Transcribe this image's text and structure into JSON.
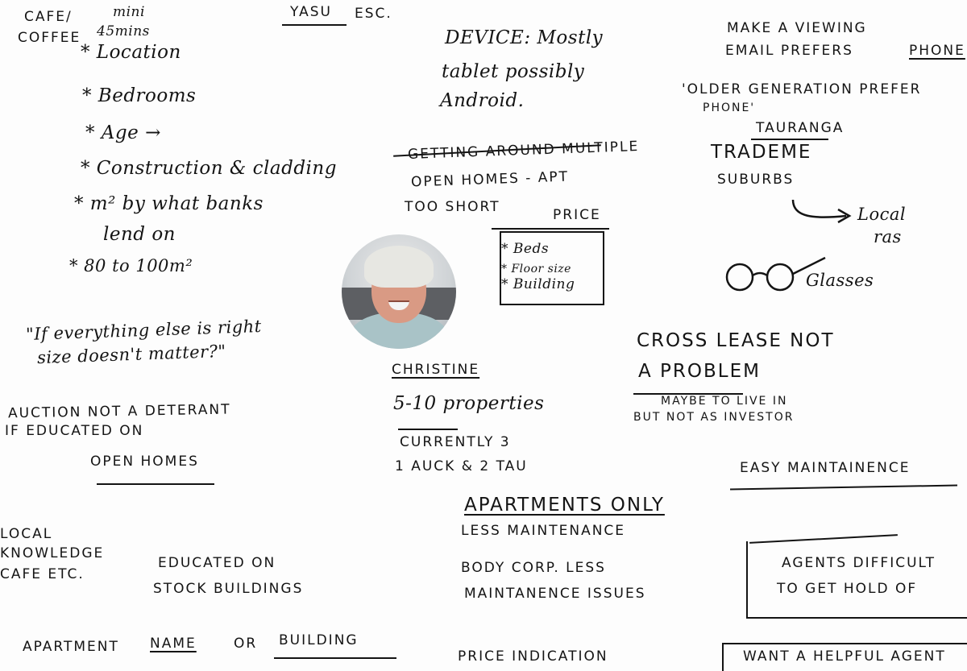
{
  "colors": {
    "ink": "#141414",
    "paper": "#fdfdfd"
  },
  "persona": {
    "name": "Christine",
    "photo_icon": "person-photo"
  },
  "notes": {
    "cafe": "CAFE/",
    "coffee": "COFFEE",
    "mini": "mini",
    "mins": "45mins",
    "yasu": "YASU",
    "esc": "esc.",
    "priorities": [
      "* Location",
      "* Bedrooms",
      "* Age →",
      "* Construction & cladding",
      "* m² by what banks",
      "lend on",
      "* 80 to 100m²"
    ],
    "quote_line1": "\"If everything else is right",
    "quote_line2": "size doesn't matter?\"",
    "auction_line1": "AUCTION NOT A DETERANT",
    "auction_line2": "IF EDUCATED ON",
    "open_homes": "OPEN HOMES",
    "local_line1": "LOCAL",
    "local_line2": "KNOWLEDGE",
    "local_line3": "CAFE ETC.",
    "educated_line1": "EDUCATED ON",
    "educated_line2": "STOCK BUILDINGS",
    "apartment_name_prefix": "APARTMENT",
    "apartment_name_mid": "NAME",
    "apartment_name_or": "OR",
    "apartment_name_end": "BUILDING",
    "device_line1": "DEVICE: Mostly",
    "device_line2": "tablet possibly",
    "device_line3": "Android.",
    "getting_line1": "GETTING AROUND MULTIPLE",
    "getting_line2": "OPEN HOMES - APT",
    "getting_line3": "TOO SHORT",
    "price_title": "PRICE",
    "price_items": [
      "* Beds",
      "* Floor size",
      "* Building"
    ],
    "christine_label": "CHRISTINE",
    "properties": "5-10 properties",
    "currently": "CURRENTLY 3",
    "auck_tau": "1 AUCK & 2 TAU",
    "apartments_only": "APARTMENTS ONLY",
    "less_maintenance": "LESS MAINTENANCE",
    "body_corp_line1": "BODY CORP. LESS",
    "body_corp_line2": "MAINTANENCE ISSUES",
    "price_indication": "PRICE INDICATION",
    "viewing_line1": "MAKE A VIEWING",
    "viewing_line2": "EMAIL PREFERS",
    "viewing_phone": "PHONE",
    "older_line1": "'OLDER GENERATION PREFER",
    "older_line2": "PHONE'",
    "tauranga": "TAURANGA",
    "trademe": "TRADEME",
    "suburbs": "SUBURBS",
    "local_line": "Local",
    "local_ras": "ras",
    "glasses": "Glasses",
    "glasses_icon": "glasses-icon",
    "cross_lease_line1": "CROSS LEASE NOT",
    "cross_lease_line2": "A PROBLEM",
    "maybe_line1": "MAYBE TO LIVE IN",
    "maybe_line2": "BUT NOT AS INVESTOR",
    "easy_maintenance": "EASY MAINTAINENCE",
    "agents_line1": "AGENTS DIFFICULT",
    "agents_line2": "TO GET HOLD OF",
    "helpful_agent": "WANT A HELPFUL AGENT"
  }
}
